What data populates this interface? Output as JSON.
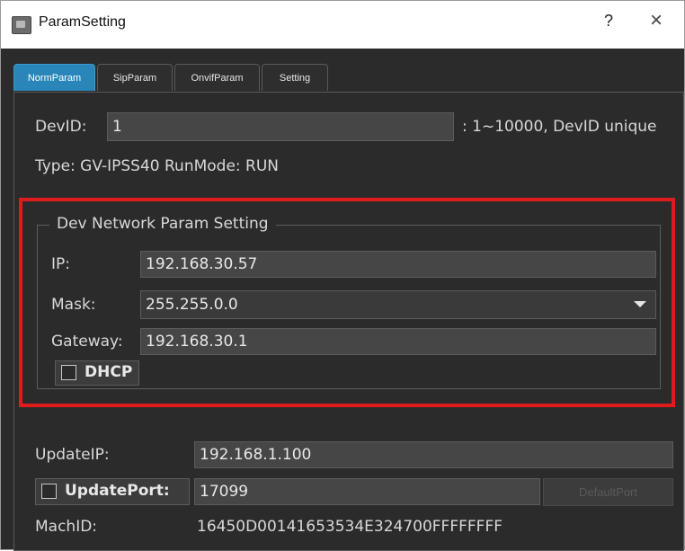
{
  "window": {
    "title": "ParamSetting",
    "help_label": "?",
    "close_label": "×"
  },
  "tabs": [
    {
      "label": "NormParam",
      "active": true
    },
    {
      "label": "SipParam",
      "active": false
    },
    {
      "label": "OnvifParam",
      "active": false
    },
    {
      "label": "Setting",
      "active": false
    }
  ],
  "device": {
    "devid_label": "DevID:",
    "devid_value": "1",
    "devid_hint": ": 1~10000, DevID unique",
    "type_text": "Type: GV-IPSS40 RunMode: RUN"
  },
  "network_group": {
    "title": "Dev Network Param Setting",
    "ip_label": "IP:",
    "ip_value": "192.168.30.57",
    "mask_label": "Mask:",
    "mask_value": "255.255.0.0",
    "gateway_label": "Gateway:",
    "gateway_value": "192.168.30.1",
    "dhcp_label": "DHCP",
    "dhcp_checked": false
  },
  "update": {
    "updateip_label": "UpdateIP:",
    "updateip_value": "192.168.1.100",
    "updateport_label": "UpdatePort:",
    "updateport_checked": false,
    "updateport_value": "17099",
    "default_port_label": "DefaultPort",
    "machid_label": "MachID:",
    "machid_value": "16450D00141653534E324700FFFFFFFF"
  },
  "colors": {
    "background": "#2b2b2b",
    "tab_active": "#2a86b8",
    "highlight_border": "#e01b1b",
    "field_bg": "#464646"
  }
}
